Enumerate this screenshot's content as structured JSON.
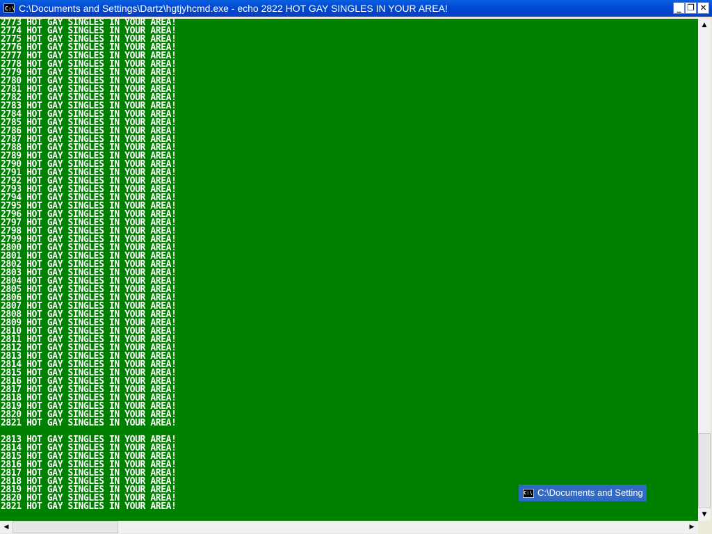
{
  "window": {
    "title": "C:\\Documents and Settings\\Dartz\\hgtjyhcmd.exe - echo 2822 HOT GAY SINGLES IN YOUR AREA!",
    "icon": "cmd-icon",
    "icon_glyph": "C:\\",
    "minimize_glyph": "_",
    "restore_glyph": "❐",
    "close_glyph": "✕"
  },
  "console": {
    "background": "#008000",
    "foreground": "#ffffff",
    "lines": [
      "2773 HOT GAY SINGLES IN YOUR AREA!",
      "2774 HOT GAY SINGLES IN YOUR AREA!",
      "2775 HOT GAY SINGLES IN YOUR AREA!",
      "2776 HOT GAY SINGLES IN YOUR AREA!",
      "2777 HOT GAY SINGLES IN YOUR AREA!",
      "2778 HOT GAY SINGLES IN YOUR AREA!",
      "2779 HOT GAY SINGLES IN YOUR AREA!",
      "2780 HOT GAY SINGLES IN YOUR AREA!",
      "2781 HOT GAY SINGLES IN YOUR AREA!",
      "2782 HOT GAY SINGLES IN YOUR AREA!",
      "2783 HOT GAY SINGLES IN YOUR AREA!",
      "2784 HOT GAY SINGLES IN YOUR AREA!",
      "2785 HOT GAY SINGLES IN YOUR AREA!",
      "2786 HOT GAY SINGLES IN YOUR AREA!",
      "2787 HOT GAY SINGLES IN YOUR AREA!",
      "2788 HOT GAY SINGLES IN YOUR AREA!",
      "2789 HOT GAY SINGLES IN YOUR AREA!",
      "2790 HOT GAY SINGLES IN YOUR AREA!",
      "2791 HOT GAY SINGLES IN YOUR AREA!",
      "2792 HOT GAY SINGLES IN YOUR AREA!",
      "2793 HOT GAY SINGLES IN YOUR AREA!",
      "2794 HOT GAY SINGLES IN YOUR AREA!",
      "2795 HOT GAY SINGLES IN YOUR AREA!",
      "2796 HOT GAY SINGLES IN YOUR AREA!",
      "2797 HOT GAY SINGLES IN YOUR AREA!",
      "2798 HOT GAY SINGLES IN YOUR AREA!",
      "2799 HOT GAY SINGLES IN YOUR AREA!",
      "2800 HOT GAY SINGLES IN YOUR AREA!",
      "2801 HOT GAY SINGLES IN YOUR AREA!",
      "2802 HOT GAY SINGLES IN YOUR AREA!",
      "2803 HOT GAY SINGLES IN YOUR AREA!",
      "2804 HOT GAY SINGLES IN YOUR AREA!",
      "2805 HOT GAY SINGLES IN YOUR AREA!",
      "2806 HOT GAY SINGLES IN YOUR AREA!",
      "2807 HOT GAY SINGLES IN YOUR AREA!",
      "2808 HOT GAY SINGLES IN YOUR AREA!",
      "2809 HOT GAY SINGLES IN YOUR AREA!",
      "2810 HOT GAY SINGLES IN YOUR AREA!",
      "2811 HOT GAY SINGLES IN YOUR AREA!",
      "2812 HOT GAY SINGLES IN YOUR AREA!",
      "2813 HOT GAY SINGLES IN YOUR AREA!",
      "2814 HOT GAY SINGLES IN YOUR AREA!",
      "2815 HOT GAY SINGLES IN YOUR AREA!",
      "2816 HOT GAY SINGLES IN YOUR AREA!",
      "2817 HOT GAY SINGLES IN YOUR AREA!",
      "2818 HOT GAY SINGLES IN YOUR AREA!",
      "2819 HOT GAY SINGLES IN YOUR AREA!",
      "2820 HOT GAY SINGLES IN YOUR AREA!",
      "2821 HOT GAY SINGLES IN YOUR AREA!",
      "",
      "2813 HOT GAY SINGLES IN YOUR AREA!",
      "2814 HOT GAY SINGLES IN YOUR AREA!",
      "2815 HOT GAY SINGLES IN YOUR AREA!",
      "2816 HOT GAY SINGLES IN YOUR AREA!",
      "2817 HOT GAY SINGLES IN YOUR AREA!",
      "2818 HOT GAY SINGLES IN YOUR AREA!",
      "2819 HOT GAY SINGLES IN YOUR AREA!",
      "2820 HOT GAY SINGLES IN YOUR AREA!",
      "2821 HOT GAY SINGLES IN YOUR AREA!"
    ]
  },
  "scrollbars": {
    "up_glyph": "▲",
    "down_glyph": "▼",
    "left_glyph": "◀",
    "right_glyph": "▶"
  },
  "taskbar_popup": {
    "label": "C:\\Documents and Setting",
    "icon_glyph": "C:\\"
  }
}
